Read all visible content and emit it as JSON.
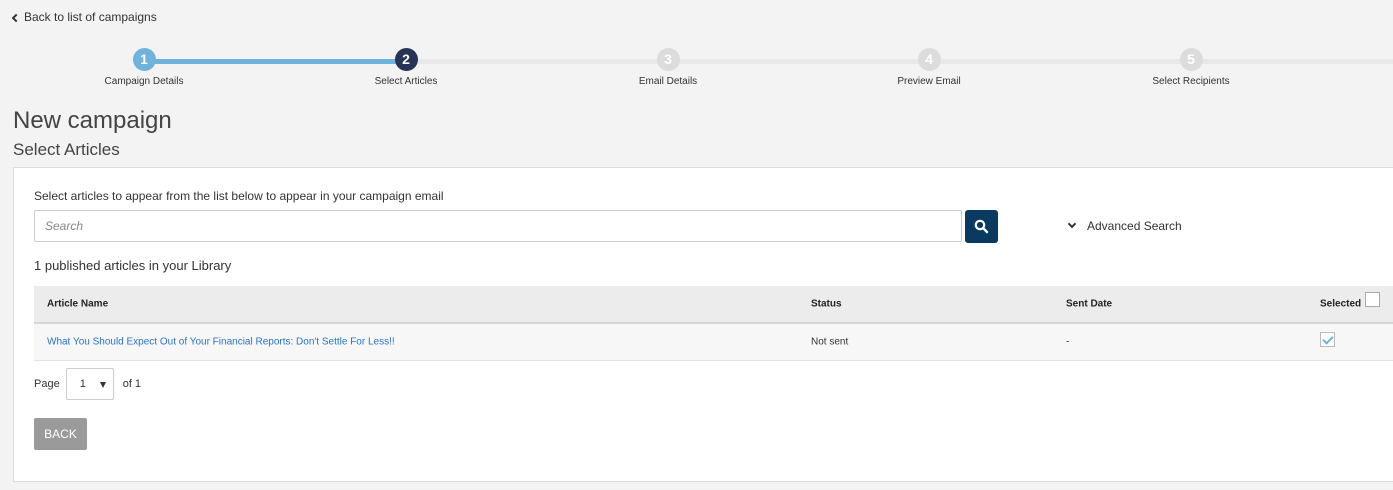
{
  "nav": {
    "back_label": "Back to list of campaigns"
  },
  "stepper": {
    "steps": [
      {
        "number": "1",
        "label": "Campaign Details",
        "state": "done"
      },
      {
        "number": "2",
        "label": "Select Articles",
        "state": "active"
      },
      {
        "number": "3",
        "label": "Email Details",
        "state": "todo"
      },
      {
        "number": "4",
        "label": "Preview Email",
        "state": "todo"
      },
      {
        "number": "5",
        "label": "Select Recipients",
        "state": "todo"
      }
    ]
  },
  "page": {
    "title": "New campaign",
    "subtitle": "Select Articles"
  },
  "panel": {
    "instructions": "Select articles to appear from the list below to appear in your campaign email",
    "search_placeholder": "Search",
    "advanced_search_label": "Advanced Search",
    "count_text": "1 published articles in your Library"
  },
  "table": {
    "headers": {
      "name": "Article Name",
      "status": "Status",
      "sent_date": "Sent Date",
      "selected": "Selected"
    },
    "rows": [
      {
        "name": "What You Should Expect Out of Your Financial Reports: Don't Settle For Less!!",
        "status": "Not sent",
        "sent_date": "-",
        "selected": true
      }
    ]
  },
  "pager": {
    "page_label": "Page",
    "current_page": "1",
    "of_label": "of 1"
  },
  "actions": {
    "back_label": "BACK"
  },
  "colors": {
    "accent": "#6fb3dc",
    "active_step": "#283358",
    "search_button": "#0a3a5f",
    "link": "#2a74c9"
  }
}
